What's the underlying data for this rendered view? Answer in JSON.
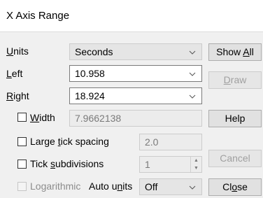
{
  "window": {
    "title": "X Axis Range"
  },
  "units": {
    "label_pre": "",
    "label_mn": "U",
    "label_post": "nits",
    "value": "Seconds"
  },
  "left": {
    "label_mn": "L",
    "label_post": "eft",
    "value": "10.958"
  },
  "right": {
    "label_mn": "R",
    "label_post": "ight",
    "value": "18.924"
  },
  "width": {
    "label_mn": "W",
    "label_post": "idth",
    "value": "7.9662138",
    "checked": false
  },
  "large_tick": {
    "label_pre": "Large ",
    "label_mn": "t",
    "label_post": "ick spacing",
    "value": "2.0",
    "checked": false
  },
  "tick_sub": {
    "label_pre": "Tick ",
    "label_mn": "s",
    "label_post": "ubdivisions",
    "value": "1",
    "checked": false
  },
  "logarithmic": {
    "label_pre": "Lo",
    "label_mn": "g",
    "label_post": "arithmic",
    "checked": false,
    "enabled": false
  },
  "auto_units": {
    "label_pre": "Auto u",
    "label_mn": "n",
    "label_post": "its",
    "value": "Off"
  },
  "buttons": {
    "show_all": {
      "pre": "Show ",
      "mn": "A",
      "post": "ll"
    },
    "draw": {
      "pre": "",
      "mn": "D",
      "post": "raw"
    },
    "help": {
      "label": "Help"
    },
    "cancel": {
      "label": "Cancel"
    },
    "close": {
      "pre": "Cl",
      "mn": "o",
      "post": "se"
    }
  },
  "icons": {
    "dropdown": "chevron-down-icon",
    "spin_up": "spin-up-icon",
    "spin_down": "spin-down-icon"
  }
}
